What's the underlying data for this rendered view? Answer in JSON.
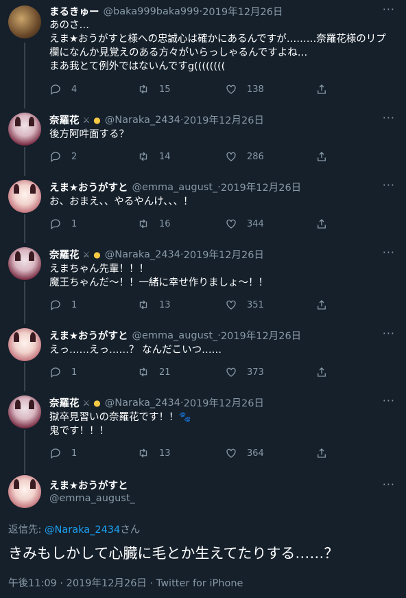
{
  "tweets": [
    {
      "name": "まるきゅー",
      "handle": "@baka999baka999",
      "date": "2019年12月26日",
      "lines": [
        "あのさ…",
        "えま★おうがすと様への忠誠心は確かにあるんですが………奈羅花様のリプ",
        "欄になんか見覚えのある方々がいらっしゃるんですよね…",
        "まあ我とて例外ではないんですg(((((((("
      ],
      "replies": "4",
      "retweets": "15",
      "likes": "138"
    },
    {
      "name": "奈羅花",
      "handle": "@Naraka_2434",
      "date": "2019年12月26日",
      "lines": [
        "後方阿吽面する？"
      ],
      "replies": "2",
      "retweets": "14",
      "likes": "286"
    },
    {
      "name": "えま★おうがすと",
      "handle": "@emma_august_",
      "date": "2019年12月26日",
      "lines": [
        "お、おまえ、、やるやんけ、、、！"
      ],
      "replies": "1",
      "retweets": "16",
      "likes": "344"
    },
    {
      "name": "奈羅花",
      "handle": "@Naraka_2434",
      "date": "2019年12月26日",
      "lines": [
        "えまちゃん先輩！！！",
        "魔王ちゃんだ〜！！一緒に幸せ作りましょ〜！！"
      ],
      "replies": "1",
      "retweets": "13",
      "likes": "351"
    },
    {
      "name": "えま★おうがすと",
      "handle": "@emma_august_",
      "date": "2019年12月26日",
      "lines": [
        "えっ……えっ……？ なんだこいつ……"
      ],
      "replies": "1",
      "retweets": "21",
      "likes": "373"
    },
    {
      "name": "奈羅花",
      "handle": "@Naraka_2434",
      "date": "2019年12月26日",
      "lines": [
        "獄卒見習いの奈羅花です！！🐾",
        "鬼です！！！"
      ],
      "replies": "1",
      "retweets": "13",
      "likes": "364"
    }
  ],
  "main": {
    "name": "えま★おうがすと",
    "handle": "@emma_august_",
    "reply_prefix": "返信先: ",
    "reply_to": "@Naraka_2434",
    "reply_suffix": "さん",
    "text": "きみもしかして心臓に毛とか生えてたりする……？",
    "timestamp": "午後11:09 · 2019年12月26日 · Twitter for iPhone"
  },
  "separator": " · ",
  "more_glyph": "···",
  "colors": {
    "background": "#15202b",
    "muted": "#8899a6",
    "link": "#1da1f2",
    "thread_line": "#38444d"
  }
}
